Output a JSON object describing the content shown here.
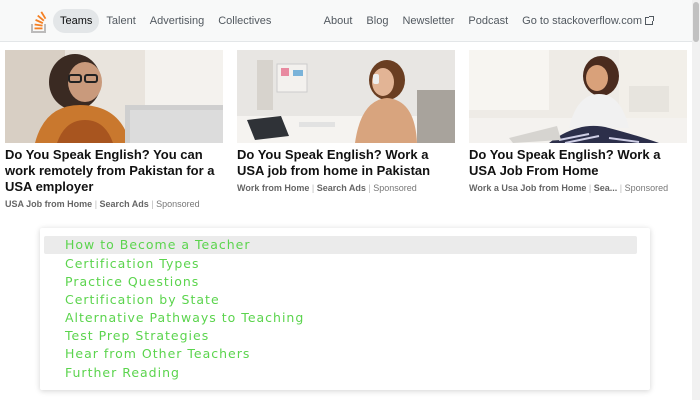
{
  "nav": {
    "logo_icon": "stackoverflow-logo-icon",
    "left_items": [
      {
        "label": "Teams",
        "active": true
      },
      {
        "label": "Talent"
      },
      {
        "label": "Advertising"
      },
      {
        "label": "Collectives"
      }
    ],
    "right_items": [
      {
        "label": "About"
      },
      {
        "label": "Blog"
      },
      {
        "label": "Newsletter"
      },
      {
        "label": "Podcast"
      },
      {
        "label": "Go to stackoverflow.com"
      }
    ],
    "external_icon": "external-link-icon"
  },
  "ads": [
    {
      "title": "Do You Speak English? You can work remotely from Pakistan for a USA employer",
      "source": "USA Job from Home",
      "tag": "Search Ads",
      "sponsored": "Sponsored"
    },
    {
      "title": "Do You Speak English? Work a USA job from home in Pakistan",
      "source": "Work from Home",
      "tag": "Search Ads",
      "sponsored": "Sponsored"
    },
    {
      "title": "Do You Speak English? Work a USA Job From Home",
      "source": "Work a Usa Job from Home",
      "tag": "Sea...",
      "sponsored": "Sponsored"
    }
  ],
  "toc": {
    "items": [
      "How to Become a Teacher",
      "Certification Types",
      "Practice Questions",
      "Certification by State",
      "Alternative Pathways to Teaching",
      "Test Prep Strategies",
      "Hear from Other Teachers",
      "Further Reading"
    ],
    "accent_color": "#5bd44d"
  },
  "colors": {
    "nav_bg": "#f8f9f9",
    "active_pill": "#e3e6e8",
    "logo_orange": "#f48024"
  }
}
